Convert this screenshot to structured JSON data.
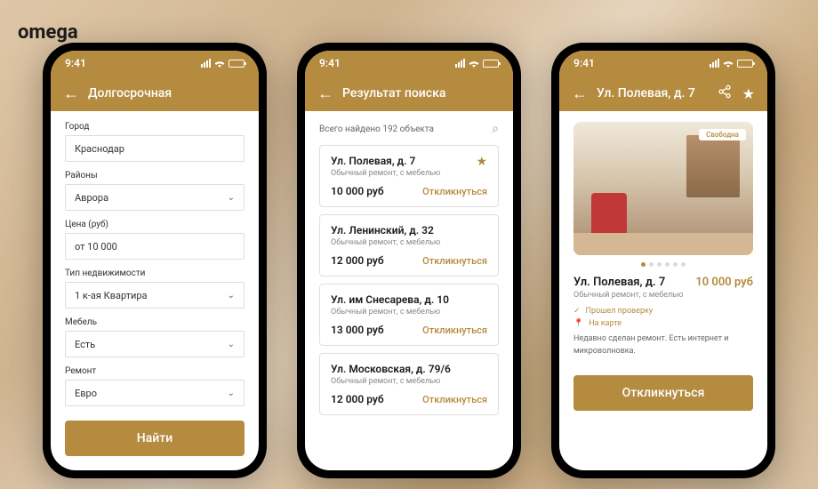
{
  "brand": "omega",
  "status": {
    "time": "9:41"
  },
  "screen1": {
    "title": "Долгосрочная",
    "fields": {
      "city": {
        "label": "Город",
        "value": "Краснодар"
      },
      "district": {
        "label": "Районы",
        "value": "Аврора"
      },
      "price": {
        "label": "Цена (руб)",
        "value": "от 10 000"
      },
      "type": {
        "label": "Тип недвижимости",
        "value": "1 к-ая Квартира"
      },
      "furniture": {
        "label": "Мебель",
        "value": "Есть"
      },
      "repair": {
        "label": "Ремонт",
        "value": "Евро"
      }
    },
    "submit": "Найти"
  },
  "screen2": {
    "title": "Результат поиска",
    "summary": "Всего найдено 192 объекта",
    "items": [
      {
        "title": "Ул. Полевая, д. 7",
        "sub": "Обычный ремонт, с мебелью",
        "price": "10 000 руб",
        "action": "Откликнуться",
        "fav": true
      },
      {
        "title": "Ул. Ленинский, д. 32",
        "sub": "Обычный ремонт, с мебелью",
        "price": "12 000 руб",
        "action": "Откликнуться"
      },
      {
        "title": "Ул. им Снесарева, д. 10",
        "sub": "Обычный ремонт, с мебелью",
        "price": "13 000 руб",
        "action": "Откликнуться"
      },
      {
        "title": "Ул. Московская, д. 79/6",
        "sub": "Обычный ремонт, с мебелью",
        "price": "12 000 руб",
        "action": "Откликнуться"
      }
    ]
  },
  "screen3": {
    "title": "Ул. Полевая, д. 7",
    "badge": "Свободна",
    "detail_title": "Ул. Полевая, д. 7",
    "price": "10 000 руб",
    "sub": "Обычный ремонт, с мебелью",
    "verified": "Прошел проверку",
    "map": "На карте",
    "desc": "Недавно сделан ремонт. Есть интернет и микроволновка.",
    "action": "Откликнуться"
  }
}
